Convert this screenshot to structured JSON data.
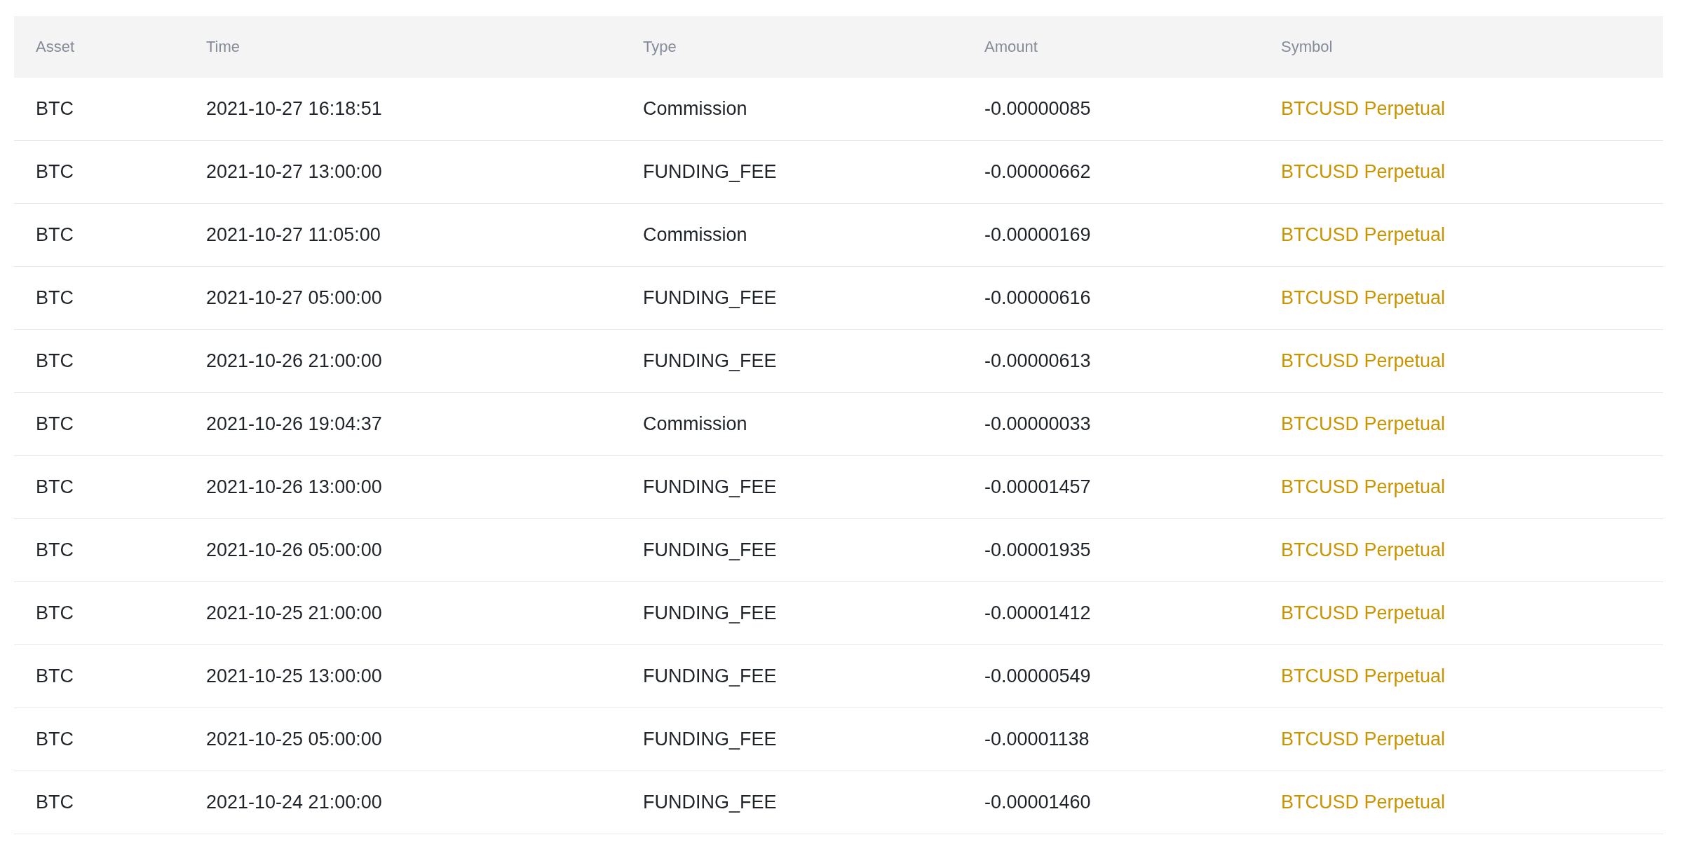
{
  "table": {
    "columns": [
      "Asset",
      "Time",
      "Type",
      "Amount",
      "Symbol"
    ],
    "rows": [
      {
        "asset": "BTC",
        "time": "2021-10-27 16:18:51",
        "type": "Commission",
        "amount": "-0.00000085",
        "symbol": "BTCUSD Perpetual"
      },
      {
        "asset": "BTC",
        "time": "2021-10-27 13:00:00",
        "type": "FUNDING_FEE",
        "amount": "-0.00000662",
        "symbol": "BTCUSD Perpetual"
      },
      {
        "asset": "BTC",
        "time": "2021-10-27 11:05:00",
        "type": "Commission",
        "amount": "-0.00000169",
        "symbol": "BTCUSD Perpetual"
      },
      {
        "asset": "BTC",
        "time": "2021-10-27 05:00:00",
        "type": "FUNDING_FEE",
        "amount": "-0.00000616",
        "symbol": "BTCUSD Perpetual"
      },
      {
        "asset": "BTC",
        "time": "2021-10-26 21:00:00",
        "type": "FUNDING_FEE",
        "amount": "-0.00000613",
        "symbol": "BTCUSD Perpetual"
      },
      {
        "asset": "BTC",
        "time": "2021-10-26 19:04:37",
        "type": "Commission",
        "amount": "-0.00000033",
        "symbol": "BTCUSD Perpetual"
      },
      {
        "asset": "BTC",
        "time": "2021-10-26 13:00:00",
        "type": "FUNDING_FEE",
        "amount": "-0.00001457",
        "symbol": "BTCUSD Perpetual"
      },
      {
        "asset": "BTC",
        "time": "2021-10-26 05:00:00",
        "type": "FUNDING_FEE",
        "amount": "-0.00001935",
        "symbol": "BTCUSD Perpetual"
      },
      {
        "asset": "BTC",
        "time": "2021-10-25 21:00:00",
        "type": "FUNDING_FEE",
        "amount": "-0.00001412",
        "symbol": "BTCUSD Perpetual"
      },
      {
        "asset": "BTC",
        "time": "2021-10-25 13:00:00",
        "type": "FUNDING_FEE",
        "amount": "-0.00000549",
        "symbol": "BTCUSD Perpetual"
      },
      {
        "asset": "BTC",
        "time": "2021-10-25 05:00:00",
        "type": "FUNDING_FEE",
        "amount": "-0.00001138",
        "symbol": "BTCUSD Perpetual"
      },
      {
        "asset": "BTC",
        "time": "2021-10-24 21:00:00",
        "type": "FUNDING_FEE",
        "amount": "-0.00001460",
        "symbol": "BTCUSD Perpetual"
      }
    ]
  }
}
